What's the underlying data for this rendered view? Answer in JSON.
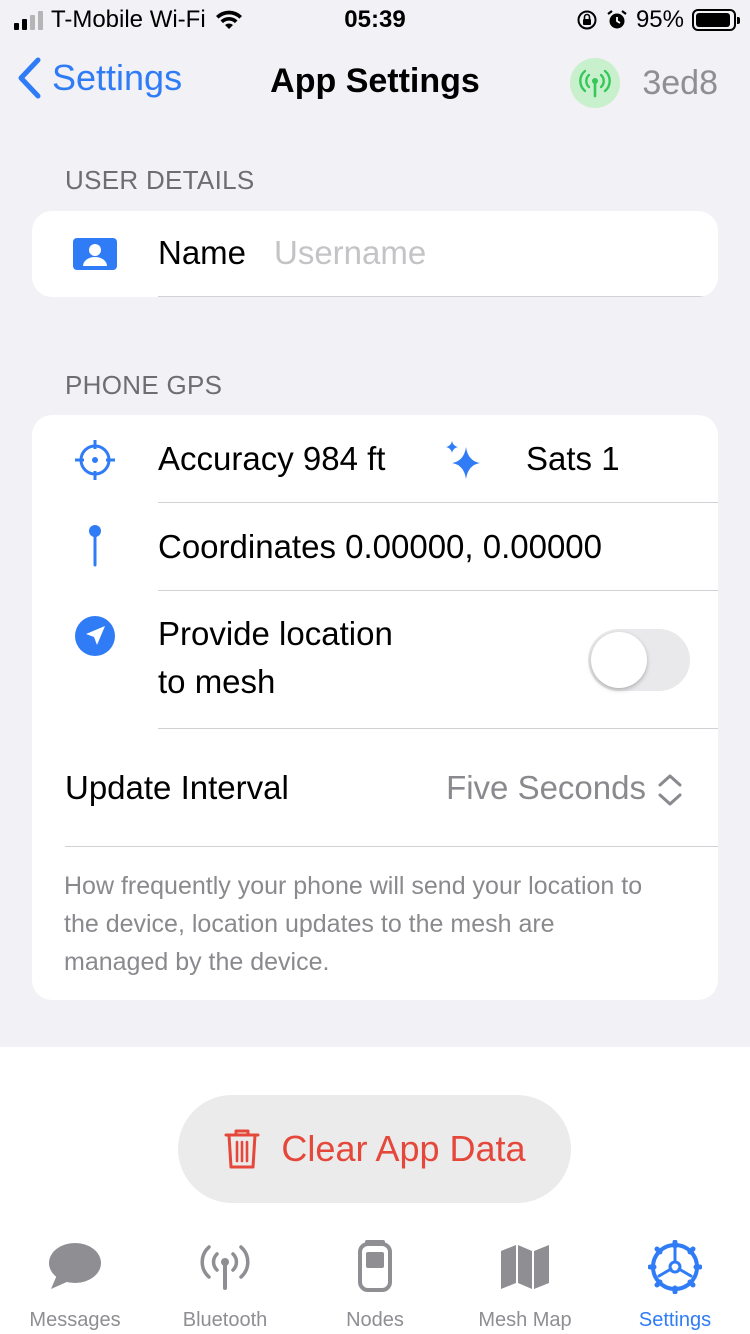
{
  "status_bar": {
    "carrier": "T-Mobile Wi-Fi",
    "time": "05:39",
    "battery": "95%"
  },
  "nav": {
    "back_label": "Settings",
    "title": "App Settings",
    "node_id": "3ed8"
  },
  "user_details": {
    "header": "USER DETAILS",
    "name_label": "Name",
    "name_placeholder": "Username",
    "name_value": ""
  },
  "phone_gps": {
    "header": "PHONE GPS",
    "accuracy": "Accuracy 984 ft",
    "sats": "Sats 1",
    "coordinates": "Coordinates 0.00000, 0.00000",
    "provide_location_line1": "Provide location",
    "provide_location_line2": "to mesh",
    "provide_location_enabled": false,
    "update_interval_label": "Update Interval",
    "update_interval_value": "Five Seconds",
    "note": "How frequently your phone will send your location to the device, location updates to the mesh are managed by the device."
  },
  "clear_button_label": "Clear App Data",
  "tabs": [
    {
      "label": "Messages",
      "icon": "message-bubble-icon",
      "active": false
    },
    {
      "label": "Bluetooth",
      "icon": "antenna-icon",
      "active": false
    },
    {
      "label": "Nodes",
      "icon": "device-icon",
      "active": false
    },
    {
      "label": "Mesh Map",
      "icon": "map-icon",
      "active": false
    },
    {
      "label": "Settings",
      "icon": "gear-icon",
      "active": true
    }
  ],
  "colors": {
    "accent": "#2f7cf6",
    "destructive": "#e5483b",
    "background": "#f1f1f6",
    "connected_badge": "#c9f0cc"
  }
}
